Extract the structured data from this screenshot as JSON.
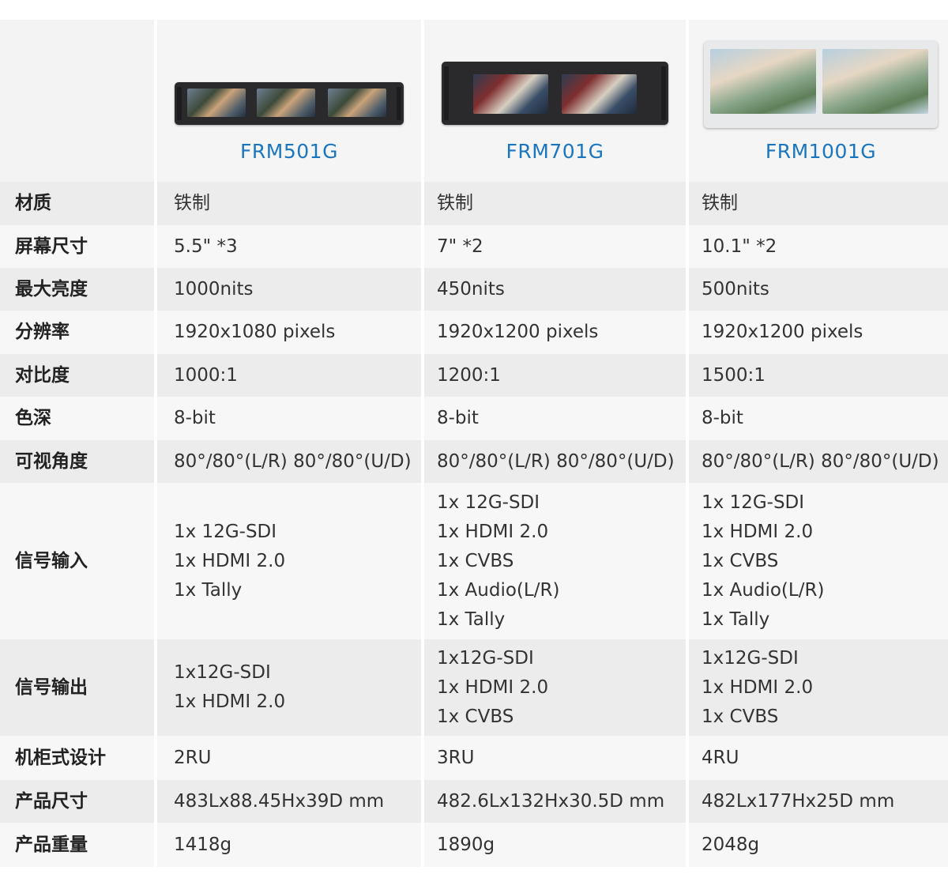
{
  "models": [
    "FRM501G",
    "FRM701G",
    "FRM1001G"
  ],
  "rows": [
    {
      "label": "材质",
      "values": [
        "铁制",
        "铁制",
        "铁制"
      ]
    },
    {
      "label": "屏幕尺寸",
      "values": [
        "5.5\" *3",
        "7\" *2",
        "10.1\" *2"
      ]
    },
    {
      "label": "最大亮度",
      "values": [
        "1000nits",
        "450nits",
        "500nits"
      ]
    },
    {
      "label": "分辨率",
      "values": [
        "1920x1080 pixels",
        "1920x1200 pixels",
        "1920x1200 pixels"
      ]
    },
    {
      "label": "对比度",
      "values": [
        "1000:1",
        "1200:1",
        "1500:1"
      ]
    },
    {
      "label": "色深",
      "values": [
        "8-bit",
        "8-bit",
        "8-bit"
      ]
    },
    {
      "label": "可视角度",
      "values": [
        "80°/80°(L/R) 80°/80°(U/D)",
        "80°/80°(L/R) 80°/80°(U/D)",
        "80°/80°(L/R) 80°/80°(U/D)"
      ]
    },
    {
      "label": "信号输入",
      "values": [
        "1x 12G-SDI\n1x HDMI 2.0\n1x Tally",
        "1x 12G-SDI\n1x HDMI 2.0\n1x CVBS\n1x Audio(L/R)\n1x Tally",
        "1x 12G-SDI\n1x HDMI 2.0\n1x CVBS\n1x Audio(L/R)\n1x Tally"
      ]
    },
    {
      "label": "信号输出",
      "values": [
        "1x12G-SDI\n1x HDMI 2.0",
        "1x12G-SDI\n1x HDMI 2.0\n1x CVBS",
        "1x12G-SDI\n1x HDMI 2.0\n1x CVBS"
      ]
    },
    {
      "label": "机柜式设计",
      "values": [
        "2RU",
        "3RU",
        "4RU"
      ]
    },
    {
      "label": "产品尺寸",
      "values": [
        "483Lx88.45Hx39D mm",
        "482.6Lx132Hx30.5D mm",
        "482Lx177Hx25D mm"
      ]
    },
    {
      "label": "产品重量",
      "values": [
        "1418g",
        "1890g",
        "2048g"
      ]
    }
  ]
}
